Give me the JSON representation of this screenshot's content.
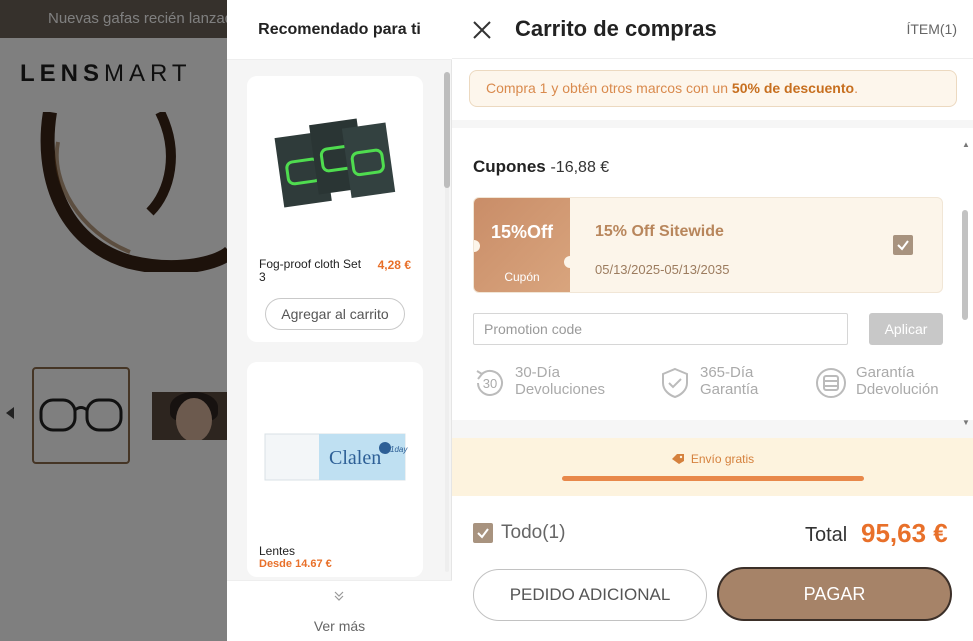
{
  "background_page": {
    "announcement": "Nuevas gafas recién lanzad",
    "logo_bold": "LENS",
    "logo_thin": "MART"
  },
  "recommended": {
    "title": "Recomendado para ti",
    "items": [
      {
        "name": "Fog-proof cloth Set 3",
        "price": "4,28 €",
        "add_label": "Agregar al carrito",
        "image_icon": "cloth-pack-icon"
      },
      {
        "name": "Lentes",
        "price": "Desde 14.67 €",
        "brand_text": "Clalen",
        "brand_sub": "1day"
      }
    ],
    "more_label": "Ver más"
  },
  "cart": {
    "title": "Carrito de compras",
    "item_count": "ÍTEM(1)",
    "promo_banner": {
      "prefix": "Compra 1 y obtén otros marcos con un ",
      "highlight": "50% de descuento",
      "suffix": "."
    },
    "coupons": {
      "label": "Cupones",
      "amount": "-16,88 €",
      "coupon": {
        "badge": "15%Off",
        "badge_sub": "Cupón",
        "name": "15% Off Sitewide",
        "dates": "05/13/2025-05/13/2035",
        "checked": true
      }
    },
    "promotion": {
      "placeholder": "Promotion code",
      "apply_label": "Aplicar"
    },
    "features": [
      {
        "icon": "30-day-return-icon",
        "badge": "30",
        "line1": "30-Día",
        "line2": "Devoluciones"
      },
      {
        "icon": "shield-check-icon",
        "line1": "365-Día",
        "line2": "Garantía"
      },
      {
        "icon": "money-back-icon",
        "line1": "Garantía",
        "line2": "Ddevolución"
      }
    ],
    "shipping": {
      "label": "Envío gratis",
      "progress": 1.0
    },
    "footer": {
      "all_label": "Todo(1)",
      "total_label": "Total",
      "total_amount": "95,63 €",
      "extra_order_label": "PEDIDO ADICIONAL",
      "pay_label": "PAGAR"
    }
  },
  "colors": {
    "accent": "#e8702a",
    "pay_button": "#a68368",
    "coupon_badge": "#c98d68",
    "checkbox": "#a8937f"
  }
}
